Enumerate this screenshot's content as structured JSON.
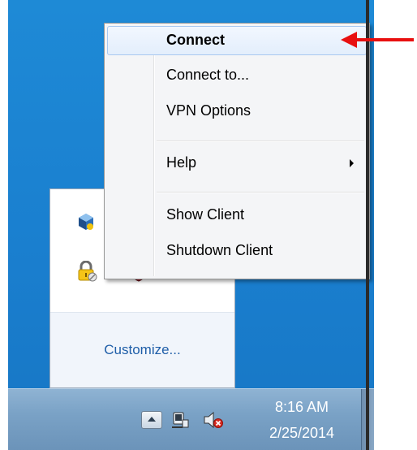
{
  "context_menu": {
    "items": [
      {
        "label": "Connect",
        "highlighted": true
      },
      {
        "label": "Connect to..."
      },
      {
        "label": "VPN Options"
      },
      {
        "label": "Help",
        "has_submenu": true
      },
      {
        "label": "Show Client"
      },
      {
        "label": "Shutdown Client"
      }
    ]
  },
  "overflow_panel": {
    "customize_label": "Customize...",
    "icons": [
      "virtualbox-icon",
      "lock-icon",
      "shield-icon",
      "vpn-client-icon"
    ]
  },
  "taskbar": {
    "tray_icons": [
      "show-hidden-icons-button",
      "network-icon",
      "volume-muted-icon"
    ],
    "clock": {
      "time": "8:16 AM",
      "date": "2/25/2014"
    }
  },
  "colors": {
    "desktop_blue": "#1a7fcf",
    "menu_bg": "#f4f5f7",
    "highlight_border": "#a8c8f0",
    "link": "#1f5ea8",
    "arrow_red": "#e81010"
  }
}
